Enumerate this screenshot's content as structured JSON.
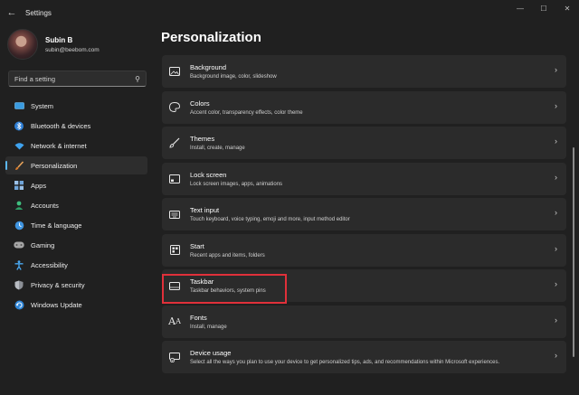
{
  "window": {
    "title": "Settings",
    "back_icon": "back-arrow-icon",
    "controls": {
      "minimize": "—",
      "maximize": "☐",
      "close": "✕"
    }
  },
  "profile": {
    "name": "Subin B",
    "email": "subin@beebom.com"
  },
  "search": {
    "placeholder": "Find a setting",
    "icon": "search-icon"
  },
  "sidebar": {
    "items": [
      {
        "label": "System",
        "icon": "system-icon",
        "active": false
      },
      {
        "label": "Bluetooth & devices",
        "icon": "bluetooth-icon",
        "active": false
      },
      {
        "label": "Network & internet",
        "icon": "wifi-icon",
        "active": false
      },
      {
        "label": "Personalization",
        "icon": "brush-icon",
        "active": true
      },
      {
        "label": "Apps",
        "icon": "apps-icon",
        "active": false
      },
      {
        "label": "Accounts",
        "icon": "person-icon",
        "active": false
      },
      {
        "label": "Time & language",
        "icon": "globe-clock-icon",
        "active": false
      },
      {
        "label": "Gaming",
        "icon": "gamepad-icon",
        "active": false
      },
      {
        "label": "Accessibility",
        "icon": "accessibility-icon",
        "active": false
      },
      {
        "label": "Privacy & security",
        "icon": "shield-icon",
        "active": false
      },
      {
        "label": "Windows Update",
        "icon": "update-icon",
        "active": false
      }
    ]
  },
  "main": {
    "title": "Personalization",
    "cards": [
      {
        "title": "Background",
        "desc": "Background image, color, slideshow",
        "icon": "image-icon"
      },
      {
        "title": "Colors",
        "desc": "Accent color, transparency effects, color theme",
        "icon": "palette-icon"
      },
      {
        "title": "Themes",
        "desc": "Install, create, manage",
        "icon": "brush-icon"
      },
      {
        "title": "Lock screen",
        "desc": "Lock screen images, apps, animations",
        "icon": "lock-screen-icon"
      },
      {
        "title": "Text input",
        "desc": "Touch keyboard, voice typing, emoji and more, input method editor",
        "icon": "keyboard-icon"
      },
      {
        "title": "Start",
        "desc": "Recent apps and items, folders",
        "icon": "start-icon"
      },
      {
        "title": "Taskbar",
        "desc": "Taskbar behaviors, system pins",
        "icon": "taskbar-icon"
      },
      {
        "title": "Fonts",
        "desc": "Install, manage",
        "icon": "font-icon"
      },
      {
        "title": "Device usage",
        "desc": "Select all the ways you plan to use your device to get personalized tips, ads, and recommendations within Microsoft experiences.",
        "icon": "device-usage-icon"
      }
    ]
  },
  "colors": {
    "accent": "#5cb8f5",
    "highlight": "#e0303a",
    "background": "#202020",
    "card": "#2b2b2b"
  }
}
